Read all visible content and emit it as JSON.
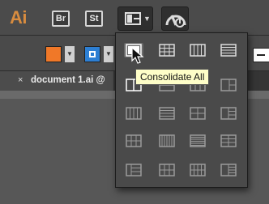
{
  "app": {
    "logo": "Ai",
    "logo_color": "#d88c3f"
  },
  "app_bar": {
    "bridge_label": "Br",
    "stock_label": "St"
  },
  "control_bar": {
    "fill_color": "#f07828",
    "stroke_color": "#2d7fd3"
  },
  "document_tab": {
    "close": "×",
    "title": "document 1.ai @"
  },
  "arrange_menu": {
    "tooltip": "Consolidate All",
    "selected": "consolidate-all"
  },
  "icons": {
    "arrange_documents": "arrange-documents-icon",
    "gpu_performance": "gpu-performance-icon",
    "cursor": "pointer-cursor"
  }
}
